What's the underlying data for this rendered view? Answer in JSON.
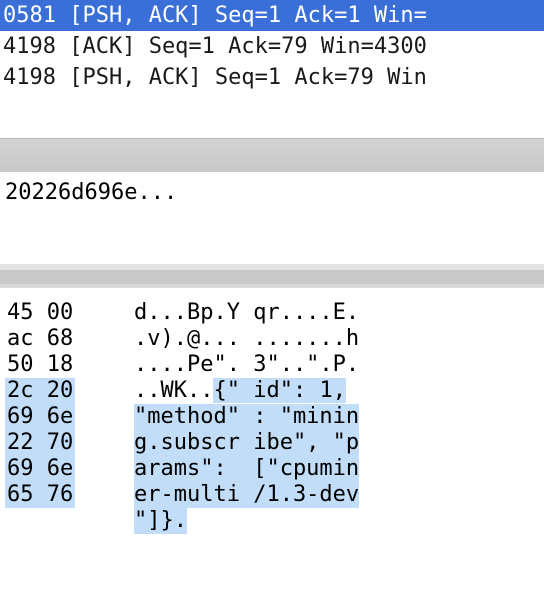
{
  "packet_list": {
    "rows": [
      {
        "text": "0581 [PSH, ACK] Seq=1 Ack=1 Win=",
        "selected": true
      },
      {
        "text": "4198 [ACK] Seq=1 Ack=79 Win=4300",
        "selected": false
      },
      {
        "text": "4198 [PSH, ACK] Seq=1 Ack=79 Win",
        "selected": false
      }
    ]
  },
  "details": {
    "line": "20226d696e..."
  },
  "bytes_pane": {
    "lines": [
      {
        "hex": "45 00",
        "ascii_plain": "d...Bp.Y qr....E.",
        "ascii_hl": ""
      },
      {
        "hex": "ac 68",
        "ascii_plain": ".v).@... .......h",
        "ascii_hl": ""
      },
      {
        "hex": "50 18",
        "ascii_plain": "....Pe\". 3\"..\".P.",
        "ascii_hl": ""
      },
      {
        "hex": "2c 20",
        "ascii_plain": "..WK..",
        "ascii_hl": "{\" id\": 1,"
      },
      {
        "hex": "69 6e",
        "ascii_plain": "",
        "ascii_hl": "\"method\" : \"minin"
      },
      {
        "hex": "22 70",
        "ascii_plain": "",
        "ascii_hl": "g.subscr ibe\", \"p"
      },
      {
        "hex": "69 6e",
        "ascii_plain": "",
        "ascii_hl": "arams\":  [\"cpumin"
      },
      {
        "hex": "65 76",
        "ascii_plain": "",
        "ascii_hl": "er-multi /1.3-dev"
      },
      {
        "hex": "",
        "ascii_plain": "",
        "ascii_hl": "\"]}."
      }
    ],
    "highlight_color": "#c2ddf8"
  },
  "colors": {
    "selected_row": "#3a6fd8",
    "splitter": "#c9c9c9"
  }
}
